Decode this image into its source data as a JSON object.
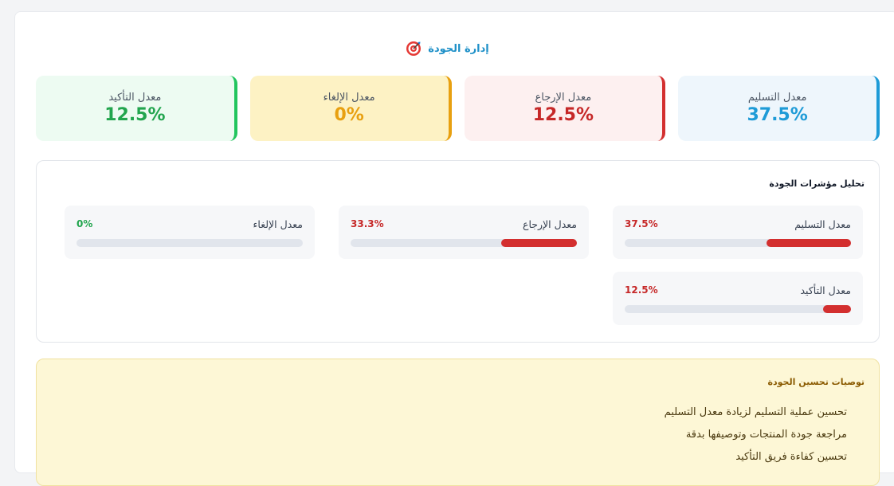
{
  "header": {
    "title": "إدارة الجودة",
    "icon": "target-icon"
  },
  "cards": [
    {
      "label": "معدل التسليم",
      "value": "37.5%",
      "bg": "#eef6fc",
      "accent": "#1e9bd7",
      "value_color": "#1e9bd7"
    },
    {
      "label": "معدل الإرجاع",
      "value": "12.5%",
      "bg": "#fdf0f0",
      "accent": "#d32f2f",
      "value_color": "#c62828"
    },
    {
      "label": "معدل الإلغاء",
      "value": "0%",
      "bg": "#fdf2c4",
      "accent": "#e8a010",
      "value_color": "#e8a010"
    },
    {
      "label": "معدل التأكيد",
      "value": "12.5%",
      "bg": "#edfbf2",
      "accent": "#22c55e",
      "value_color": "#22a54e"
    }
  ],
  "analysis": {
    "title": "تحليل مؤشرات الجودة",
    "metrics": [
      {
        "label": "معدل التسليم",
        "value": "37.5%",
        "percent": 37.5,
        "value_color": "#c62828"
      },
      {
        "label": "معدل الإرجاع",
        "value": "33.3%",
        "percent": 33.3,
        "value_color": "#c62828"
      },
      {
        "label": "معدل الإلغاء",
        "value": "0%",
        "percent": 0,
        "value_color": "#22a54e"
      },
      {
        "label": "معدل التأكيد",
        "value": "12.5%",
        "percent": 12.5,
        "value_color": "#c62828"
      }
    ]
  },
  "recommendations": {
    "title": "توصيات تحسين الجودة",
    "items": [
      "تحسين عملية التسليم لزيادة معدل التسليم",
      "مراجعة جودة المنتجات وتوصيفها بدقة",
      "تحسين كفاءة فريق التأكيد"
    ]
  }
}
